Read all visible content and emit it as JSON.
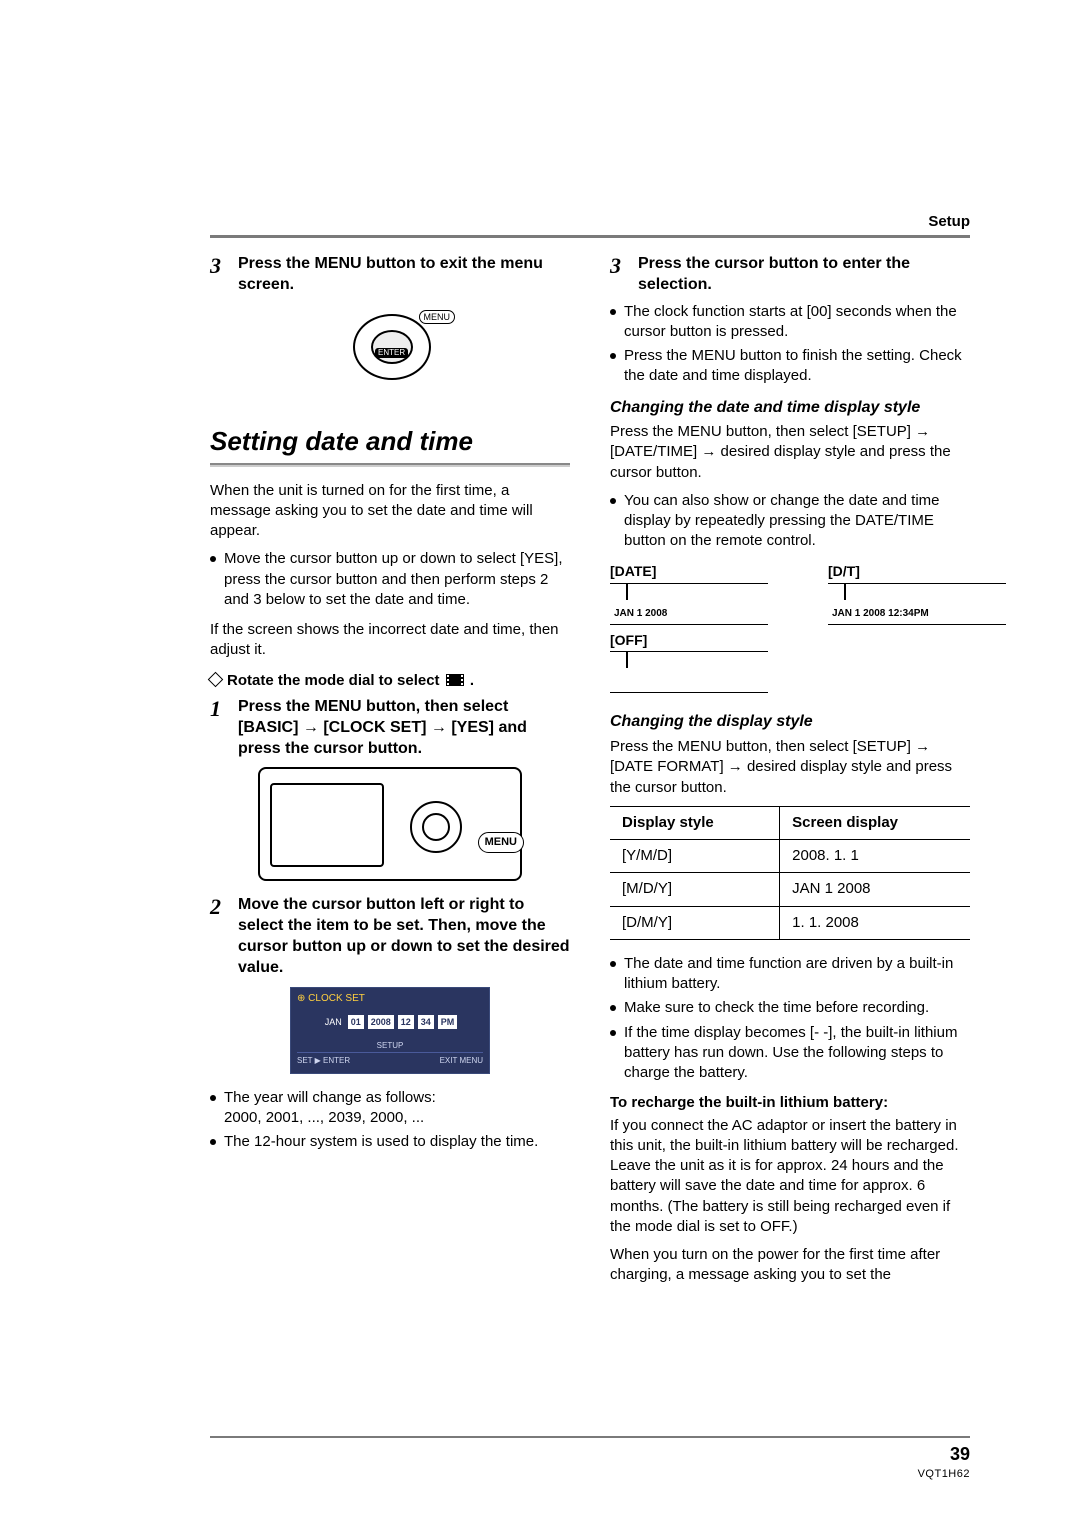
{
  "header": {
    "section": "Setup"
  },
  "left": {
    "step3top": {
      "num": "3",
      "text": "Press the MENU button to exit the menu screen."
    },
    "menuIllus": {
      "menu": "MENU",
      "enter": "ENTER"
    },
    "heading": "Setting date and time",
    "intro": "When the unit is turned on for the first time, a message asking you to set the date and time will appear.",
    "introBullet": "Move the cursor button up or down to select [YES], press the cursor button and then perform steps 2 and 3 below to set the date and time.",
    "adjustNote": "If the screen shows the incorrect date and time, then adjust it.",
    "rotate": "Rotate the mode dial to select",
    "modeIconAlt": "video-mode-icon",
    "step1": {
      "num": "1",
      "text": "Press the MENU button, then select [BASIC] → [CLOCK SET] → [YES] and press the cursor button."
    },
    "cameraMenu": "MENU",
    "step2": {
      "num": "2",
      "text": "Move the cursor button left or right to select the item to be set. Then, move the cursor button up or down to set the desired value."
    },
    "clockSet": {
      "title": "CLOCK SET",
      "cells": [
        "JAN",
        "01",
        "2008",
        "12",
        "34",
        "PM"
      ],
      "setup": "SETUP",
      "setEnter": "SET ▶ ENTER",
      "exit": "EXIT MENU"
    },
    "yearNote": "The year will change as follows:",
    "yearSeq": "2000, 2001, ..., 2039, 2000, ...",
    "hour12": "The 12-hour system is used to display the time."
  },
  "right": {
    "step3": {
      "num": "3",
      "text": "Press the cursor button to enter the selection."
    },
    "step3bullets": [
      "The clock function starts at [00] seconds when the cursor button is pressed.",
      "Press the MENU button to finish the setting. Check the date and time displayed."
    ],
    "changeDT": {
      "title": "Changing the date and time display style",
      "body": "Press the MENU button, then select [SETUP] → [DATE/TIME] → desired display style and press the cursor button.",
      "bullet": "You can also show or change the date and time display by repeatedly pressing the DATE/TIME button on the remote control."
    },
    "dt": {
      "dateLabel": "[DATE]",
      "dateVal": "JAN  1 2008",
      "dtLabel": "[D/T]",
      "dtVal": "JAN  1 2008 12:34PM",
      "offLabel": "[OFF]"
    },
    "changeDisplay": {
      "title": "Changing the display style",
      "body": "Press the MENU button, then select [SETUP] → [DATE FORMAT] → desired display style and press the cursor button."
    },
    "table": {
      "h1": "Display style",
      "h2": "Screen display",
      "rows": [
        {
          "a": "[Y/M/D]",
          "b": "2008. 1. 1"
        },
        {
          "a": "[M/D/Y]",
          "b": "JAN  1 2008"
        },
        {
          "a": "[D/M/Y]",
          "b": "1. 1. 2008"
        }
      ]
    },
    "notes": [
      "The date and time function are driven by a built-in lithium battery.",
      "Make sure to check the time before recording.",
      "If the time display becomes [- -], the built-in lithium battery has run down. Use the following steps to charge the battery."
    ],
    "recharge": {
      "title": "To recharge the built-in lithium battery:",
      "body": "If you connect the AC adaptor or insert the battery in this unit, the built-in lithium battery will be recharged. Leave the unit as it is for approx. 24 hours and the battery will save the date and time for approx. 6 months. (The battery is still being recharged even if the mode dial is set to OFF.)",
      "body2": "When you turn on the power for the first time after charging, a message asking you to set the"
    }
  },
  "footer": {
    "page": "39",
    "docid": "VQT1H62"
  }
}
